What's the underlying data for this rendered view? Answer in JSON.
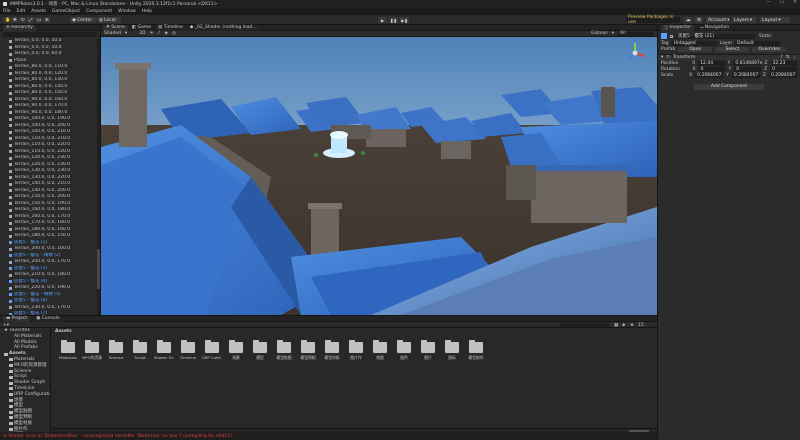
{
  "window": {
    "title": "MMPRoles3.0.1 - 场景 - PC, Mac & Linux Standalone - Unity 2020.3.12f1c1 Personal <DX11>",
    "controls": [
      "—",
      "☐",
      "✕"
    ]
  },
  "menu": [
    "File",
    "Edit",
    "Assets",
    "GameObject",
    "Component",
    "Window",
    "Help"
  ],
  "toolbar": {
    "pivot": "Center",
    "space": "Local",
    "preview_packages": "Preview Packages in use",
    "account": "Account",
    "layers": "Layers",
    "layout": "Layout"
  },
  "hierarchy": {
    "tab": "Hierarchy",
    "items": [
      {
        "label": "Terrain_0.0, 0.0, 50.0",
        "hl": false
      },
      {
        "label": "Terrain_0.0, 0.0, 50.0",
        "hl": false
      },
      {
        "label": "Terrain_0.0, 0.0, 60.0",
        "hl": false
      },
      {
        "label": "Plane",
        "hl": false
      },
      {
        "label": "Terrain_80.0, 0.0, 110.0",
        "hl": false
      },
      {
        "label": "Terrain_80.0, 0.0, 120.0",
        "hl": false
      },
      {
        "label": "Terrain_80.0, 0.0, 130.0",
        "hl": false
      },
      {
        "label": "Terrain_80.0, 0.0, 140.0",
        "hl": false
      },
      {
        "label": "Terrain_80.0, 0.0, 150.0",
        "hl": false
      },
      {
        "label": "Terrain_90.0, 0.0, 160.0",
        "hl": false
      },
      {
        "label": "Terrain_90.0, 0.0, 170.0",
        "hl": false
      },
      {
        "label": "Terrain_90.0, 0.0, 180.0",
        "hl": false
      },
      {
        "label": "Terrain_100.0, 0.0, 190.0",
        "hl": false
      },
      {
        "label": "Terrain_100.0, 0.0, 200.0",
        "hl": false
      },
      {
        "label": "Terrain_100.0, 0.0, 210.0",
        "hl": false
      },
      {
        "label": "Terrain_110.0, 0.0, 210.0",
        "hl": false
      },
      {
        "label": "Terrain_110.0, 0.0, 220.0",
        "hl": false
      },
      {
        "label": "Terrain_110.0, 0.0, 220.0",
        "hl": false
      },
      {
        "label": "Terrain_120.0, 0.0, 230.0",
        "hl": false
      },
      {
        "label": "Terrain_120.0, 0.0, 230.0",
        "hl": false
      },
      {
        "label": "Terrain_130.0, 0.0, 230.0",
        "hl": false
      },
      {
        "label": "Terrain_130.0, 0.0, 220.0",
        "hl": false
      },
      {
        "label": "Terrain_140.0, 0.0, 210.0",
        "hl": false
      },
      {
        "label": "Terrain_140.0, 0.0, 200.0",
        "hl": false
      },
      {
        "label": "Terrain_150.0, 0.0, 200.0",
        "hl": false
      },
      {
        "label": "Terrain_150.0, 0.0, 190.0",
        "hl": false
      },
      {
        "label": "Terrain_160.0, 0.0, 180.0",
        "hl": false
      },
      {
        "label": "Terrain_160.0, 0.0, 170.0",
        "hl": false
      },
      {
        "label": "Terrain_170.0, 0.0, 160.0",
        "hl": false
      },
      {
        "label": "Terrain_180.0, 0.0, 160.0",
        "hl": false
      },
      {
        "label": "Terrain_180.0, 0.0, 150.0",
        "hl": false
      },
      {
        "label": "房屋5 - 樱花 (1)",
        "hl": true
      },
      {
        "label": "Terrain_200.0, 0.0, 160.0",
        "hl": false
      },
      {
        "label": "房屋5 - 樱花 - 精致 (2)",
        "hl": true
      },
      {
        "label": "Terrain_200.0, 0.0, 170.0",
        "hl": false
      },
      {
        "label": "房屋5 - 樱花 (3)",
        "hl": true
      },
      {
        "label": "Terrain_210.0, 0.0, 180.0",
        "hl": false
      },
      {
        "label": "房屋5 - 樱花 (4)",
        "hl": true
      },
      {
        "label": "Terrain_220.0, 0.0, 190.0",
        "hl": false
      },
      {
        "label": "房屋5 - 樱花 - 精致 (5)",
        "hl": true
      },
      {
        "label": "房屋5 - 樱花 (6)",
        "hl": true
      },
      {
        "label": "Terrain_230.0, 0.0, 170.0",
        "hl": false
      },
      {
        "label": "房屋5 - 樱花 (7)",
        "hl": true
      },
      {
        "label": "Terrain_240.0, 0.0, 160.0",
        "hl": false
      },
      {
        "label": "房屋5 - 樱花 - 精致 (8)",
        "hl": true
      },
      {
        "label": "Terrain_240.0, 0.0, 150.0",
        "hl": false
      },
      {
        "label": "房屋5 - 樱花 (9)",
        "hl": true
      },
      {
        "label": "房屋5 - 樱花 - 精致 (10)",
        "hl": true
      },
      {
        "label": "房屋5 - 樱花 (11)",
        "hl": true
      },
      {
        "label": "Terrain_250.0, 0.0, 140.0",
        "hl": false
      },
      {
        "label": "房屋5 - 樱花 (12)",
        "hl": true
      },
      {
        "label": "Terrain_260.0, 0.0, 130.0",
        "hl": false
      },
      {
        "label": "房屋5 - 樱花 (13)",
        "hl": true
      }
    ]
  },
  "scene": {
    "tabs": [
      "Scene",
      "Game",
      "Timeline",
      "_02_Shader (nothing load..."
    ],
    "shading": "Shaded",
    "gizmos": "Gizmos",
    "search_placeholder": "All"
  },
  "inspector": {
    "tabs": [
      "Inspector",
      "Navigation"
    ],
    "object_name": "房屋5 - 樱花 (21)",
    "static": "Static",
    "tag_label": "Tag",
    "tag": "Untagged",
    "layer_label": "Layer",
    "layer": "Default",
    "prefab_label": "Prefab",
    "open": "Open",
    "select": "Select",
    "overrides": "Overrides",
    "transform": "Transform",
    "position": {
      "label": "Position",
      "x": "12.44",
      "y": "0.8146897e",
      "z": "32.23"
    },
    "rotation": {
      "label": "Rotation",
      "x": "0",
      "y": "0",
      "z": "0"
    },
    "scale": {
      "label": "Scale",
      "x": "0.2084007",
      "y": "0.2084007",
      "z": "0.2084007"
    },
    "add_component": "Add Component"
  },
  "project": {
    "tabs": [
      "Project",
      "Console"
    ],
    "favorites": [
      "All Materials",
      "All Models",
      "All Prefabs"
    ],
    "tree": [
      "Assets",
      "Materials",
      "MFO的资源管理",
      "Science",
      "Script",
      "Shader Graph",
      "TimeLine",
      "URP Configuration",
      "场景",
      "模型",
      "模型贴图",
      "模型预制",
      "模型材质",
      "图片作",
      "地图",
      "插件"
    ],
    "breadcrumb": "Assets",
    "items": [
      "Materials",
      "MFO的资源",
      "Science",
      "Script",
      "Shader Gr...",
      "Timeline",
      "URP Confi...",
      "场景",
      "模型",
      "模型贴图",
      "模型预制",
      "模型材质",
      "图片作",
      "地图",
      "插件",
      "图片",
      "图标",
      "模型制作"
    ],
    "count": "15"
  },
  "status": {
    "message": "Shader error in 'Distortion/Blur' : unrecognized identifier 'Distortion' on line 7 (compiling for d3d11)"
  }
}
